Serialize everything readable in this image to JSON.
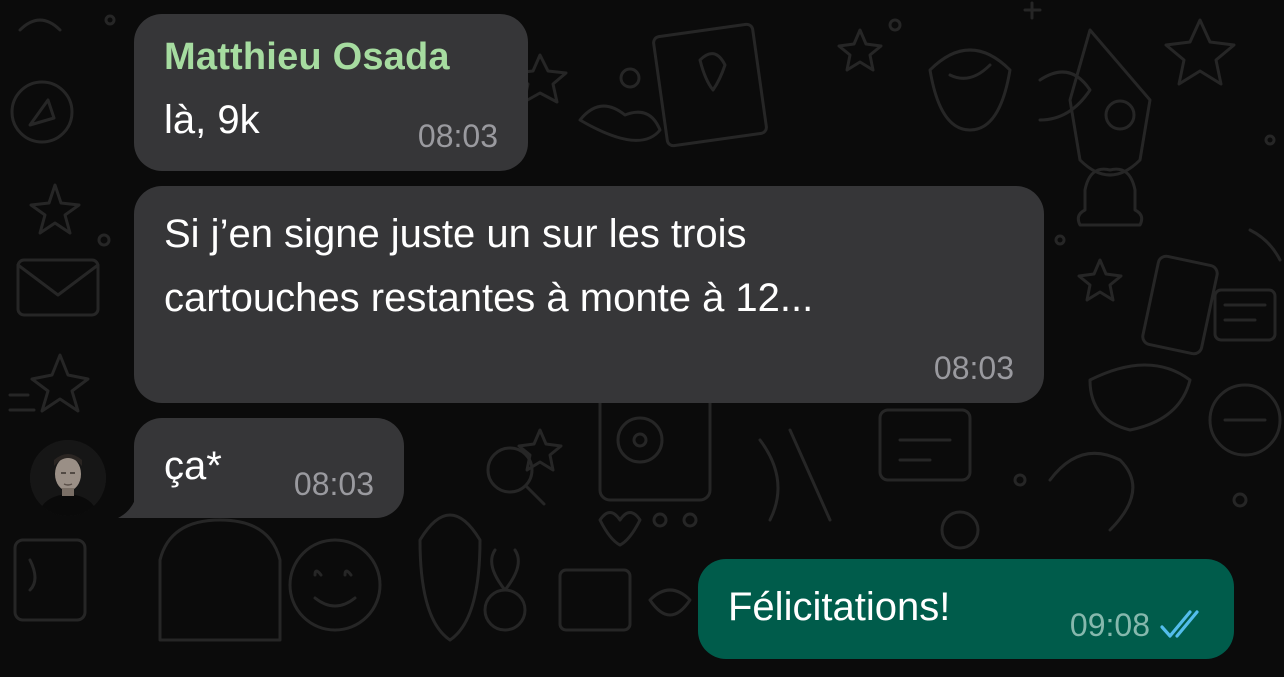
{
  "colors": {
    "background": "#0b0b0b",
    "incoming_bubble": "#363638",
    "outgoing_bubble": "#005c4b",
    "sender_name": "#a6dca0",
    "read_ticks": "#53bdeb"
  },
  "messages": [
    {
      "direction": "incoming",
      "sender": "Matthieu Osada",
      "lines": [
        "là, 9k"
      ],
      "time": "08:03"
    },
    {
      "direction": "incoming",
      "lines": [
        "Si j’en signe juste un sur les trois",
        "cartouches restantes à monte à 12..."
      ],
      "time": "08:03"
    },
    {
      "direction": "incoming",
      "lines": [
        "ça*"
      ],
      "time": "08:03",
      "avatar": "contact-avatar"
    },
    {
      "direction": "outgoing",
      "lines": [
        "Félicitations!"
      ],
      "time": "09:08",
      "status_icon": "double-check-read-icon"
    }
  ]
}
